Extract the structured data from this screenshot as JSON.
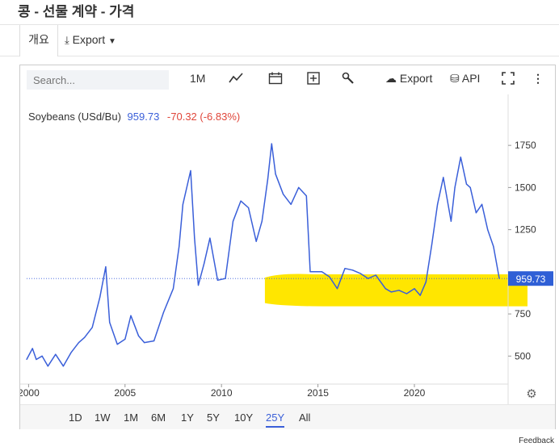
{
  "page": {
    "title": "콩 - 선물 계약 - 가격"
  },
  "tabs": {
    "overview": "개요",
    "export": "Export"
  },
  "toolbar": {
    "search_placeholder": "Search...",
    "interval": "1M",
    "export": "Export",
    "api": "API"
  },
  "legend": {
    "name": "Soybeans (USd/Bu)",
    "price": "959.73",
    "change": "-70.32 (-6.83%)"
  },
  "last_price_label": "959.73",
  "ranges": [
    "1D",
    "1W",
    "1M",
    "6M",
    "1Y",
    "5Y",
    "10Y",
    "25Y",
    "All"
  ],
  "active_range": "25Y",
  "feedback": "Feedback",
  "colors": {
    "line": "#3a5fd9",
    "highlight": "#ffe600",
    "last_label_bg": "#2f5fd6"
  },
  "chart_data": {
    "type": "line",
    "title": "",
    "xlabel": "",
    "ylabel": "",
    "x_ticks": [
      "2000",
      "2005",
      "2010",
      "2015",
      "2020"
    ],
    "y_ticks": [
      500,
      750,
      1000,
      1250,
      1500,
      1750
    ],
    "ylim": [
      310,
      1880
    ],
    "xlim": [
      1999.9,
      2024.9
    ],
    "grid": false,
    "series": [
      {
        "name": "Soybeans (USd/Bu)",
        "x": [
          1999.9,
          2000.2,
          2000.4,
          2000.7,
          2001.0,
          2001.4,
          2001.8,
          2002.2,
          2002.6,
          2002.9,
          2003.3,
          2003.7,
          2004.0,
          2004.2,
          2004.6,
          2005.0,
          2005.3,
          2005.7,
          2006.0,
          2006.5,
          2007.0,
          2007.5,
          2007.8,
          2008.0,
          2008.4,
          2008.6,
          2008.8,
          2009.1,
          2009.4,
          2009.8,
          2010.2,
          2010.6,
          2011.0,
          2011.4,
          2011.8,
          2012.1,
          2012.4,
          2012.6,
          2012.8,
          2013.2,
          2013.6,
          2014.0,
          2014.4,
          2014.6,
          2014.8,
          2015.2,
          2015.6,
          2016.0,
          2016.4,
          2016.8,
          2017.2,
          2017.6,
          2018.0,
          2018.5,
          2018.8,
          2019.2,
          2019.6,
          2020.0,
          2020.3,
          2020.6,
          2020.9,
          2021.2,
          2021.5,
          2021.9,
          2022.1,
          2022.4,
          2022.7,
          2022.9,
          2023.2,
          2023.5,
          2023.8,
          2024.1,
          2024.4
        ],
        "values": [
          480,
          545,
          480,
          500,
          440,
          510,
          440,
          520,
          580,
          610,
          670,
          850,
          1030,
          700,
          570,
          600,
          740,
          620,
          580,
          590,
          760,
          900,
          1150,
          1400,
          1600,
          1200,
          920,
          1050,
          1200,
          950,
          960,
          1300,
          1420,
          1380,
          1180,
          1300,
          1550,
          1760,
          1580,
          1460,
          1400,
          1500,
          1450,
          1000,
          1000,
          1000,
          970,
          900,
          1020,
          1010,
          990,
          960,
          980,
          900,
          880,
          890,
          870,
          900,
          860,
          940,
          1160,
          1400,
          1560,
          1300,
          1500,
          1680,
          1520,
          1500,
          1350,
          1400,
          1250,
          1150,
          960
        ]
      }
    ]
  }
}
